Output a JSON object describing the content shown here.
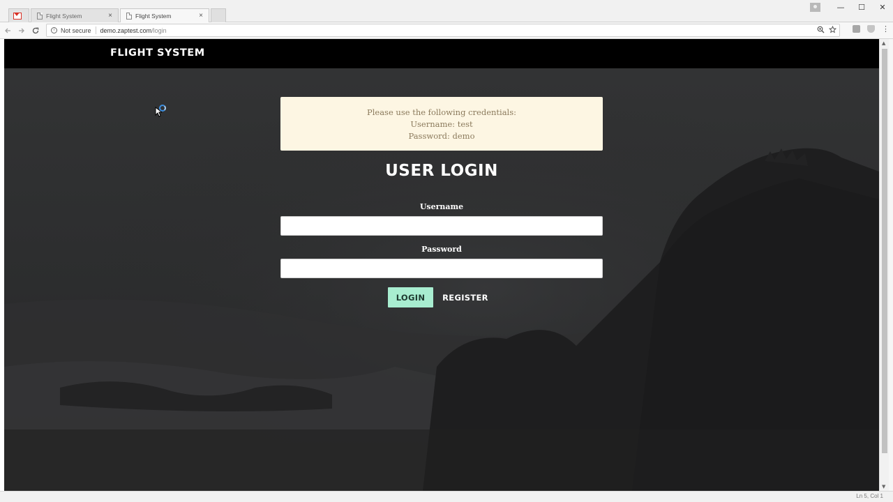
{
  "browser": {
    "tabs": [
      {
        "title": "Flight System",
        "active": false
      },
      {
        "title": "Flight System",
        "active": true
      }
    ],
    "tab_close_glyph": "×",
    "address": {
      "security_label": "Not secure",
      "host": "demo.zaptest.com",
      "path": "/login"
    },
    "icons": {
      "gmail": "gmail-icon",
      "back": "arrow-left-icon",
      "forward": "arrow-right-icon",
      "reload": "reload-icon",
      "info": "info-icon",
      "zoom": "zoom-icon",
      "bookmark": "star-icon",
      "menu": "kebab-menu-icon"
    },
    "window_controls": {
      "minimize": "—",
      "maximize": "☐",
      "close": "✕"
    }
  },
  "site": {
    "brand": "FLIGHT SYSTEM"
  },
  "credentials": {
    "line1": "Please use the following credentials:",
    "line2": "Username: test",
    "line3": "Password: demo"
  },
  "login": {
    "title": "USER LOGIN",
    "username_label": "Username",
    "username_value": "",
    "password_label": "Password",
    "password_value": "",
    "login_button": "LOGIN",
    "register_button": "REGISTER"
  },
  "colors": {
    "header_bg": "#000000",
    "page_bg": "#2a2a2b",
    "credentials_bg": "#fdf6e3",
    "credentials_text": "#8b7a5c",
    "login_button_bg": "#a8edd0",
    "busy_indicator": "#3d8fe0"
  },
  "status_bar": {
    "text": "Ln 5, Col 1"
  }
}
